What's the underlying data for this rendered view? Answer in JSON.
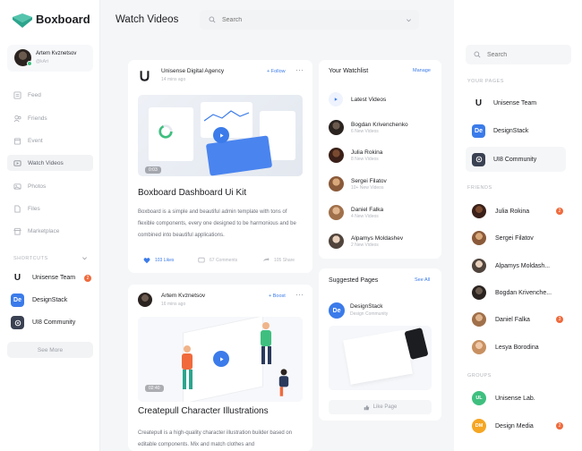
{
  "app": {
    "name": "Boxboard",
    "brand_color": "#3b7bea",
    "accent_orange": "#f06a3c"
  },
  "user": {
    "name": "Artem Kvznetsov",
    "handle": "@kArt"
  },
  "nav": [
    {
      "label": "Feed",
      "icon": "feed-icon"
    },
    {
      "label": "Friends",
      "icon": "friends-icon"
    },
    {
      "label": "Event",
      "icon": "event-icon"
    },
    {
      "label": "Watch Videos",
      "icon": "video-icon",
      "active": true
    },
    {
      "label": "Photos",
      "icon": "photos-icon"
    },
    {
      "label": "Files",
      "icon": "files-icon"
    },
    {
      "label": "Marketplace",
      "icon": "marketplace-icon"
    }
  ],
  "shortcuts": {
    "label": "SHORTCUTS",
    "items": [
      {
        "label": "Unisense Team",
        "badge": "2"
      },
      {
        "label": "DesignStack"
      },
      {
        "label": "UI8 Community"
      }
    ],
    "see_more": "See More"
  },
  "header": {
    "title": "Watch Videos",
    "search_placeholder": "Search"
  },
  "post1": {
    "author": "Unisense Digital Agency",
    "time": "14 mins ago",
    "follow": "+ Follow",
    "duration": "0:03",
    "title": "Boxboard Dashboard Ui Kit",
    "body": "Boxboard is a simple and beautiful admin template with tons of flexible components, every one designed to be harmonious and be combined into beautiful applications.",
    "likes": "103 Likes",
    "comments": "67 Comments",
    "shares": "105 Share"
  },
  "post2": {
    "author": "Artem Kvznetsov",
    "time": "16 mins ago",
    "boost": "+ Boost",
    "duration": "02:40",
    "title": "Createpull Character Illustrations",
    "body": "Createpull is a high-quality character illustration builder based on editable components. Mix and match clothes and"
  },
  "watchlist": {
    "title": "Your Watchlist",
    "manage": "Manage",
    "latest": "Latest Videos",
    "items": [
      {
        "name": "Bogdan Krivenchenko",
        "sub": "6 New Videos"
      },
      {
        "name": "Julia Rokina",
        "sub": "8 New Videos"
      },
      {
        "name": "Sergei Filatov",
        "sub": "10+ New Videos"
      },
      {
        "name": "Daniel Falka",
        "sub": "4 New Videos"
      },
      {
        "name": "Alpamys Moldashev",
        "sub": "2 New Videos"
      }
    ]
  },
  "suggested": {
    "title": "Suggested Pages",
    "see_all": "See All",
    "page_name": "DesignStack",
    "page_sub": "Design Community",
    "like": "Like Page"
  },
  "right": {
    "search_placeholder": "Search",
    "pages_label": "YOUR PAGES",
    "pages": [
      {
        "label": "Unisense Team"
      },
      {
        "label": "DesignStack"
      },
      {
        "label": "UI8 Community"
      }
    ],
    "friends_label": "FRIENDS",
    "friends": [
      {
        "name": "Julia Rokina",
        "badge": "2"
      },
      {
        "name": "Sergei Filatov"
      },
      {
        "name": "Alpamys Moldash..."
      },
      {
        "name": "Bogdan Krivenche..."
      },
      {
        "name": "Daniel Falka",
        "badge": "3"
      },
      {
        "name": "Lesya Borodina"
      }
    ],
    "groups_label": "GROUPS",
    "groups": [
      {
        "initials": "UL",
        "label": "Unisense Lab.",
        "color": "#3fbf7f"
      },
      {
        "initials": "DM",
        "label": "Design Media",
        "color": "#f5a623",
        "badge": "2"
      }
    ]
  }
}
